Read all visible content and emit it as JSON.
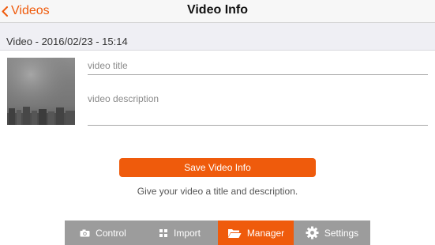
{
  "nav": {
    "back_label": "Videos",
    "title": "Video Info"
  },
  "section": {
    "title": "Video - 2016/02/23 - 15:14"
  },
  "form": {
    "title_placeholder": "video title",
    "title_value": "",
    "description_placeholder": "video description",
    "description_value": ""
  },
  "save_button": {
    "label": "Save Video Info"
  },
  "hint": "Give your video a title and description.",
  "tabs": [
    {
      "label": "Control",
      "icon": "camera-icon",
      "active": false
    },
    {
      "label": "Import",
      "icon": "grid-icon",
      "active": false
    },
    {
      "label": "Manager",
      "icon": "folder-icon",
      "active": true
    },
    {
      "label": "Settings",
      "icon": "gear-icon",
      "active": false
    }
  ],
  "colors": {
    "accent": "#ef5b0c",
    "tabbar_bg": "#9c9c9c",
    "nav_bg": "#f7f7f7",
    "section_bg": "#efeff4"
  }
}
